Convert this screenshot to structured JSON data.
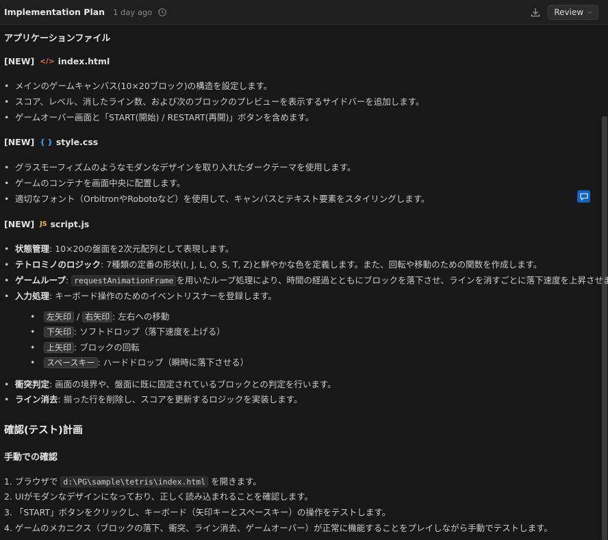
{
  "header": {
    "title": "Implementation Plan",
    "time": "1 day ago",
    "review_label": "Review"
  },
  "app_files_heading": "アプリケーションファイル",
  "files": [
    {
      "tag": "[NEW]",
      "icon_text": "</>",
      "name": "index.html",
      "bullets": [
        "メインのゲームキャンバス(10×20ブロック)の構造を設定します。",
        "スコア、レベル、消したライン数、および次のブロックのプレビューを表示するサイドバーを追加します。",
        "ゲームオーバー画面と「START(開始) / RESTART(再開)」ボタンを含めます。"
      ]
    },
    {
      "tag": "[NEW]",
      "icon_text": "{ }",
      "name": "style.css",
      "bullets": [
        "グラスモーフィズムのようなモダンなデザインを取り入れたダークテーマを使用します。",
        "ゲームのコンテナを画面中央に配置します。",
        "適切なフォント（OrbitronやRobotoなど）を使用して、キャンバスとテキスト要素をスタイリングします。"
      ]
    },
    {
      "tag": "[NEW]",
      "icon_text": "JS",
      "name": "script.js",
      "bullets": [
        {
          "bold": "状態管理",
          "text": ": 10×20の盤面を2次元配列として表現します。"
        },
        {
          "bold": "テトロミノのロジック",
          "text": ": 7種類の定番の形状(I, J, L, O, S, T, Z)と鮮やかな色を定義します。また、回転や移動のための関数を作成します。"
        },
        {
          "bold": "ゲームループ",
          "text": ": ",
          "code": "requestAnimationFrame",
          "after": "を用いたループ処理により、時間の経過とともにブロックを落下させ、ラインを消すごとに落下速度を上昇させます。"
        },
        {
          "bold": "入力処理",
          "text": ": キーボード操作のためのイベントリスナーを登録します。"
        }
      ],
      "sub_bullets": [
        {
          "keys": [
            "左矢印",
            "右矢印"
          ],
          "sep": "/",
          "text": ": 左右への移動"
        },
        {
          "keys": [
            "下矢印"
          ],
          "text": ": ソフトドロップ（落下速度を上げる）"
        },
        {
          "keys": [
            "上矢印"
          ],
          "text": ": ブロックの回転"
        },
        {
          "keys": [
            "スペースキー"
          ],
          "text": ": ハードドロップ（瞬時に落下させる）"
        }
      ],
      "more_bullets": [
        {
          "bold": "衝突判定",
          "text": ": 画面の境界や、盤面に既に固定されているブロックとの判定を行います。"
        },
        {
          "bold": "ライン消去",
          "text": ": 揃った行を削除し、スコアを更新するロジックを実装します。"
        }
      ]
    }
  ],
  "verify_heading": "確認(テスト)計画",
  "manual_heading": "手動での確認",
  "steps": [
    {
      "num": "1.",
      "pre": "ブラウザで ",
      "code": "d:\\PG\\sample\\tetris\\index.html",
      "post": " を開きます。"
    },
    {
      "num": "2.",
      "text": "UIがモダンなデザインになっており、正しく読み込まれることを確認します。"
    },
    {
      "num": "3.",
      "text": "「START」ボタンをクリックし、キーボード（矢印キーとスペースキー）の操作をテストします。"
    },
    {
      "num": "4.",
      "text": "ゲームのメカニクス（ブロックの落下、衝突、ライン消去、ゲームオーバー）が正常に機能することをプレイしながら手動でテストします。"
    }
  ],
  "colors": {
    "background": "#181818",
    "header_bg": "#1f1f1f",
    "html_icon": "#e8744f",
    "css_icon": "#3fa7f2",
    "js_icon": "#e8c33a",
    "comment_button": "#0e63c6"
  }
}
